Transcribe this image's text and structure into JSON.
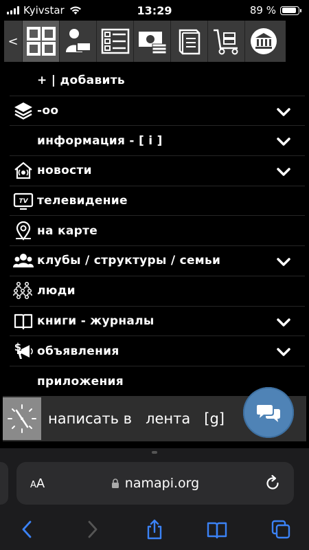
{
  "status_bar": {
    "carrier": "Kyivstar",
    "time": "13:29",
    "battery_text": "89 %",
    "battery_level": 0.89
  },
  "toolbar": {
    "back_label": "<",
    "buttons": [
      {
        "name": "grid-icon",
        "active": true
      },
      {
        "name": "user-card-icon",
        "active": false
      },
      {
        "name": "list-form-icon",
        "active": false
      },
      {
        "name": "money-icon",
        "active": false
      },
      {
        "name": "book-icon",
        "active": false
      },
      {
        "name": "cart-icon",
        "active": false
      },
      {
        "name": "institution-icon",
        "active": false
      }
    ]
  },
  "menu": {
    "items": [
      {
        "label": "+ | добавить",
        "icon": "",
        "chevron": false
      },
      {
        "label": "-оо",
        "icon": "layers-icon",
        "chevron": true
      },
      {
        "label": "информация - [ i ]",
        "icon": "",
        "chevron": true
      },
      {
        "label": "новости",
        "icon": "home-broadcast-icon",
        "chevron": true
      },
      {
        "label": "телевидение",
        "icon": "tv-icon",
        "chevron": false
      },
      {
        "label": "на карте",
        "icon": "map-pin-icon",
        "chevron": false
      },
      {
        "label": "клубы / структуры / семьи",
        "icon": "group-icon",
        "chevron": true
      },
      {
        "label": "люди",
        "icon": "people-icon",
        "chevron": false
      },
      {
        "label": "книги - журналы",
        "icon": "book-open-icon",
        "chevron": true
      },
      {
        "label": "объявления",
        "icon": "megaphone-icon",
        "chevron": true
      },
      {
        "label": "приложения",
        "icon": "",
        "chevron": false
      }
    ]
  },
  "write_bar": {
    "text": "написать в   лента   [g]"
  },
  "browser": {
    "aa_label": "AA",
    "url": "namapi.org"
  },
  "colors": {
    "background": "#000000",
    "toolbar": "#3a3a3a",
    "fab": "#4f83b6",
    "browser_chrome": "#1c1c1e",
    "nav_blue": "#3b82f6"
  }
}
